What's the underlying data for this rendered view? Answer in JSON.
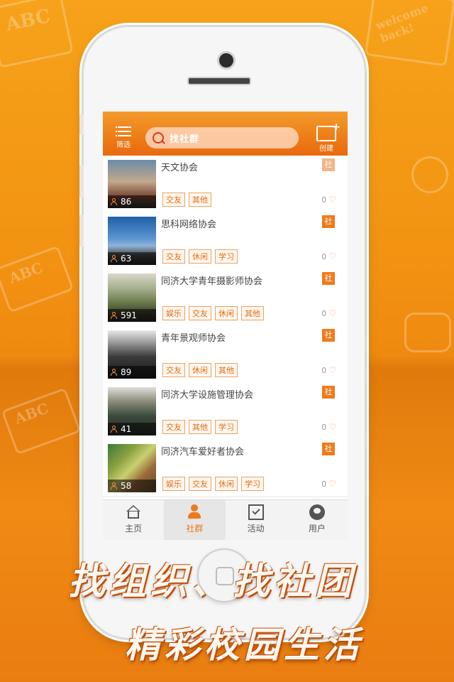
{
  "colors": {
    "accent": "#ee7a1a",
    "background": "#f29412",
    "tag_border": "#f0a060"
  },
  "header": {
    "filter_label": "筛选",
    "search_placeholder": "找社群",
    "create_label": "创建"
  },
  "items": [
    {
      "title": "天文协会",
      "members": "86",
      "badge": "社",
      "tags": [
        "交友",
        "其他"
      ],
      "likes": "0"
    },
    {
      "title": "思科网络协会",
      "members": "63",
      "badge": "社",
      "tags": [
        "交友",
        "休闲",
        "学习"
      ],
      "likes": "0"
    },
    {
      "title": "同济大学青年摄影师协会",
      "members": "591",
      "badge": "社",
      "tags": [
        "娱乐",
        "交友",
        "休闲",
        "其他"
      ],
      "likes": "0"
    },
    {
      "title": "青年景观师协会",
      "members": "89",
      "badge": "社",
      "tags": [
        "交友",
        "休闲",
        "其他"
      ],
      "likes": "0"
    },
    {
      "title": "同济大学设施管理协会",
      "members": "41",
      "badge": "社",
      "tags": [
        "交友",
        "其他",
        "学习"
      ],
      "likes": "0"
    },
    {
      "title": "同济汽车爱好者协会",
      "members": "58",
      "badge": "社",
      "tags": [
        "娱乐",
        "交友",
        "休闲",
        "学习"
      ],
      "likes": "0"
    }
  ],
  "tabs": [
    {
      "label": "主页",
      "icon": "home-icon"
    },
    {
      "label": "社群",
      "icon": "community-icon",
      "active": true
    },
    {
      "label": "活动",
      "icon": "activity-icon"
    },
    {
      "label": "用户",
      "icon": "user-icon"
    }
  ],
  "slogan": {
    "line1": "找组织、找社团",
    "line2": "精彩校园生活"
  }
}
